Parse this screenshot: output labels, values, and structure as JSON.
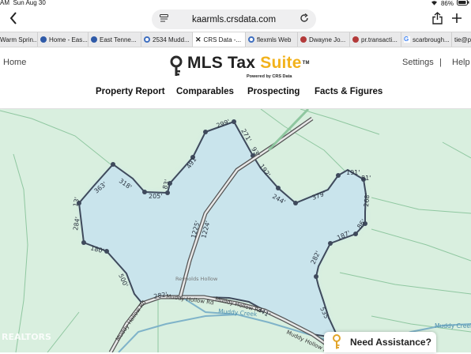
{
  "status": {
    "time": "AM",
    "date": "Sun Aug 30",
    "battery": "86%"
  },
  "browser": {
    "url": "kaarmls.crsdata.com",
    "tabs": [
      {
        "label": "Warm Sprin...",
        "fav": "#a0a0a0"
      },
      {
        "label": "Home - Eas...",
        "fav": "#2f5aa8"
      },
      {
        "label": "East Tenne...",
        "fav": "#2f5aa8"
      },
      {
        "label": "2534 Mudd...",
        "fav": "#3f6fc0"
      },
      {
        "label": "CRS Data -...",
        "fav": "#222"
      },
      {
        "label": "flexmls Web",
        "fav": "#3f6fc0"
      },
      {
        "label": "Dwayne Jo...",
        "fav": "#b33a3a"
      },
      {
        "label": "pr.transacti...",
        "fav": "#b33a3a"
      },
      {
        "label": "scarbrough...",
        "fav": "#4285f4"
      },
      {
        "label": "tie@p",
        "fav": "#888"
      }
    ]
  },
  "header": {
    "home": "Home",
    "settings": "Settings",
    "separator": "|",
    "help": "Help",
    "logo_main": "MLS Tax ",
    "logo_accent": "Suite",
    "logo_tm": "TM",
    "logo_powered": "Powered by CRS Data"
  },
  "nav": [
    "Property Report",
    "Comparables",
    "Prospecting",
    "Facts & Figures"
  ],
  "map": {
    "colors": {
      "background": "#d9efdf",
      "parcel": "#c9e4ec",
      "line": "#3f4a5c",
      "creek": "#7fb3c9",
      "road": "#555555"
    },
    "dimensions": [
      "299'",
      "271'",
      "93'",
      "491'",
      "192'",
      "363'",
      "318'",
      "205'",
      "83'",
      "244'",
      "379'",
      "191'",
      "81'",
      "268'",
      "13'",
      "284'",
      "1225'",
      "1224'",
      "187'",
      "86'",
      "180'",
      "282'",
      "500'",
      "282'",
      "341'",
      "535'"
    ],
    "road_labels": [
      "Muddy Hollow Rd",
      "Muddy Hollow Rd",
      "Muddy Hollow Rd",
      "Muddy Hollow Rd"
    ],
    "creek_labels": [
      "Muddy Creek",
      "Muddy Creek"
    ],
    "place_label": "Reynolds Hollow",
    "watermark": "REALTORS"
  },
  "assist": {
    "label": "Need Assistance?"
  }
}
